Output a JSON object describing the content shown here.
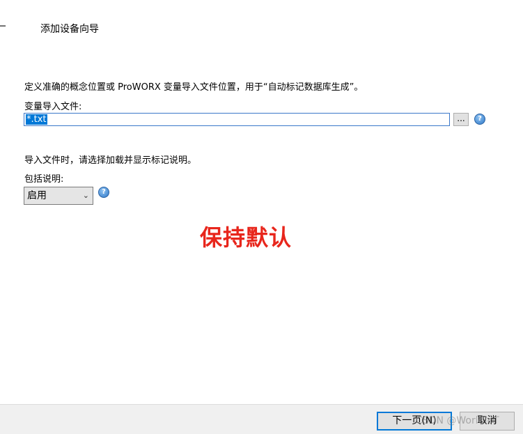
{
  "header": {
    "title": "添加设备向导"
  },
  "content": {
    "description": "定义准确的概念位置或 ProWORX 变量导入文件位置，用于“自动标记数据库生成”。",
    "file_label": "变量导入文件:",
    "file_value": "*.txt",
    "browse_label": "...",
    "include_note": "导入文件时，请选择加载并显示标记说明。",
    "include_label": "包括说明:",
    "include_selected": "启用"
  },
  "annotation": {
    "text": "保持默认"
  },
  "footer": {
    "next_label": "下一页(N)",
    "cancel_label": "取消"
  },
  "watermark": "CSDN @WorldIoT",
  "colors": {
    "accent": "#0078d7",
    "annotation_red": "#e8261c",
    "footer_bg": "#f0f0f0"
  },
  "icons": [
    "back-arrow-icon",
    "help-icon",
    "chevron-down-icon"
  ]
}
